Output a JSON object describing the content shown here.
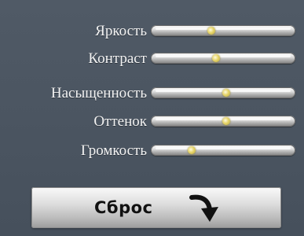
{
  "controls": {
    "sliders": [
      {
        "label": "Яркость",
        "value": 0.42
      },
      {
        "label": "Контраст",
        "value": 0.45
      },
      {
        "label": "Насыщенность",
        "value": 0.52
      },
      {
        "label": "Оттенок",
        "value": 0.52
      },
      {
        "label": "Громкость",
        "value": 0.28
      }
    ],
    "reset_label": "Сброс",
    "reset_icon": "curved-arrow-down-icon"
  },
  "colors": {
    "background": "#4b5562",
    "label_text": "#f2f2f2",
    "thumb": "#e6d46a"
  }
}
